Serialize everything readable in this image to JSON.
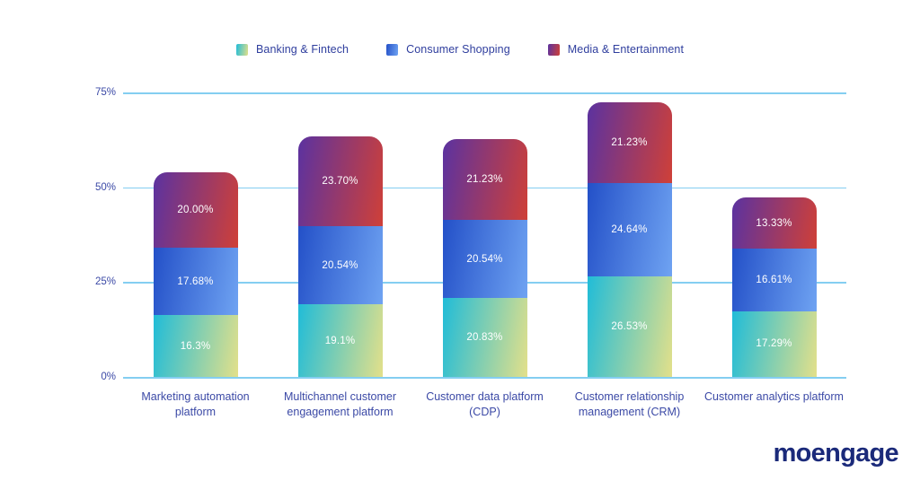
{
  "chart_data": {
    "type": "bar",
    "stacked": true,
    "title": "",
    "subtitle": "",
    "xlabel": "",
    "ylabel": "",
    "ylim": [
      0,
      75
    ],
    "yticks": [
      "0%",
      "25%",
      "50%",
      "75%"
    ],
    "ytick_values": [
      0,
      25,
      50,
      75
    ],
    "grid": true,
    "legend_position": "top-center",
    "categories": [
      "Marketing automation platform",
      "Multichannel customer engagement platform",
      "Customer data platform (CDP)",
      "Customer relationship management (CRM)",
      "Customer analytics platform"
    ],
    "series": [
      {
        "name": "Banking & Fintech",
        "values": [
          16.3,
          19.1,
          20.83,
          26.53,
          17.29
        ],
        "labels": [
          "16.3%",
          "19.1%",
          "20.83%",
          "26.53%",
          "17.29%"
        ],
        "color_start": "#20bcd8",
        "color_end": "#e3e08a"
      },
      {
        "name": "Consumer Shopping",
        "values": [
          17.68,
          20.54,
          20.54,
          24.64,
          16.61
        ],
        "labels": [
          "17.68%",
          "20.54%",
          "20.54%",
          "24.64%",
          "16.61%"
        ],
        "color_start": "#2350c8",
        "color_end": "#6fa3f2"
      },
      {
        "name": "Media & Entertainment",
        "values": [
          20.0,
          23.7,
          21.23,
          21.23,
          13.33
        ],
        "labels": [
          "20.00%",
          "23.70%",
          "21.23%",
          "21.23%",
          "13.33%"
        ],
        "color_start": "#5b32a0",
        "color_end": "#cf4038"
      }
    ],
    "totals": [
      53.98,
      63.34,
      62.6,
      72.4,
      47.23
    ],
    "grid_color": "#6ec6ef",
    "axis_text_color": "#3b49a6"
  },
  "branding": {
    "logo_text": "moengage",
    "logo_color": "#1b2a7a"
  }
}
